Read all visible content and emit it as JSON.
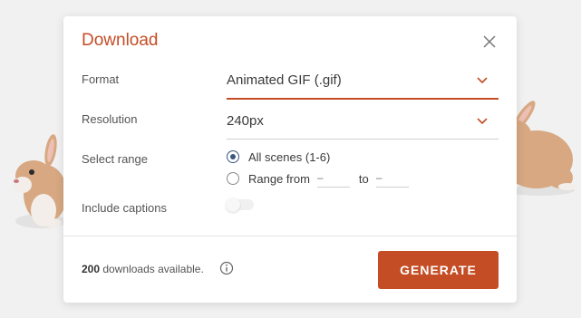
{
  "dialog": {
    "title": "Download",
    "format": {
      "label": "Format",
      "value": "Animated GIF (.gif)"
    },
    "resolution": {
      "label": "Resolution",
      "value": "240px"
    },
    "range": {
      "label": "Select range",
      "all_scenes": "All scenes (1-6)",
      "range_from": "Range from",
      "from_placeholder": "–",
      "to": "to",
      "to_placeholder": "–",
      "selected": "all_scenes"
    },
    "captions": {
      "label": "Include captions",
      "enabled": false
    },
    "footer": {
      "downloads_count": "200",
      "downloads_text": "downloads available."
    },
    "generate_label": "GENERATE"
  },
  "colors": {
    "accent": "#c44d25",
    "radio_selected": "#3b5680",
    "background": "#f1f1f1"
  },
  "icons": {
    "close": "close-icon",
    "dropdown": "chevron-down-icon",
    "info": "info-icon"
  }
}
